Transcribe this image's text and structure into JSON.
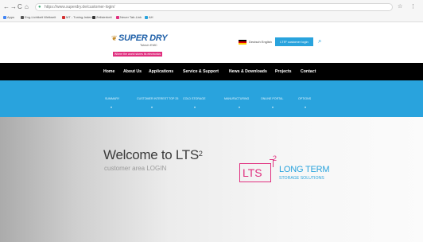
{
  "browser": {
    "url": "https://www.superdry.de/customer-login/",
    "nav": {
      "back": "←",
      "forward": "→",
      "reload": "C",
      "home": "⌂"
    },
    "right": {
      "star": "☆",
      "menu": "⋮"
    },
    "bookmarks": [
      {
        "label": "Apps",
        "color": "#4285f4"
      },
      {
        "label": "Eng-Lichtkeit Weltweit",
        "color": "#555555"
      },
      {
        "label": "MT - Tuning-Index",
        "color": "#d32f2f"
      },
      {
        "label": "Zellsterbeit",
        "color": "#333333"
      },
      {
        "label": "Neuer Tab-Link",
        "color": "#e0307f"
      },
      {
        "label": "AH",
        "color": "#29a3dd"
      }
    ]
  },
  "header": {
    "logo": {
      "title": "SUPER DRY",
      "sub": "Totech EMC",
      "tagline": "Where the world stores its electronics"
    },
    "language": "Deutsch  English",
    "customer_button": "LTS² customer login",
    "search_icon": "search-icon"
  },
  "main_nav": [
    "Home",
    "About Us",
    "Applications",
    "Service & Support",
    "News & Downloads",
    "Projects",
    "Contact"
  ],
  "sub_nav": [
    {
      "label": "Summary"
    },
    {
      "label": "Customer Interest Top 25"
    },
    {
      "label": "Cold Storage"
    },
    {
      "label": "Manufacturing"
    },
    {
      "label": "Online Portal"
    },
    {
      "label": "Options"
    }
  ],
  "hero": {
    "title": "Welcome to LTS",
    "title_sup": "2",
    "subtitle": "customer area LOGIN",
    "logo": {
      "box": "LTS",
      "sup": "2",
      "line1": "LONG TERM",
      "line2": "STORAGE SOLUTIONS"
    }
  },
  "colors": {
    "accent_blue": "#29a3dd",
    "brand_pink": "#e0307f",
    "nav_black": "#000000"
  }
}
